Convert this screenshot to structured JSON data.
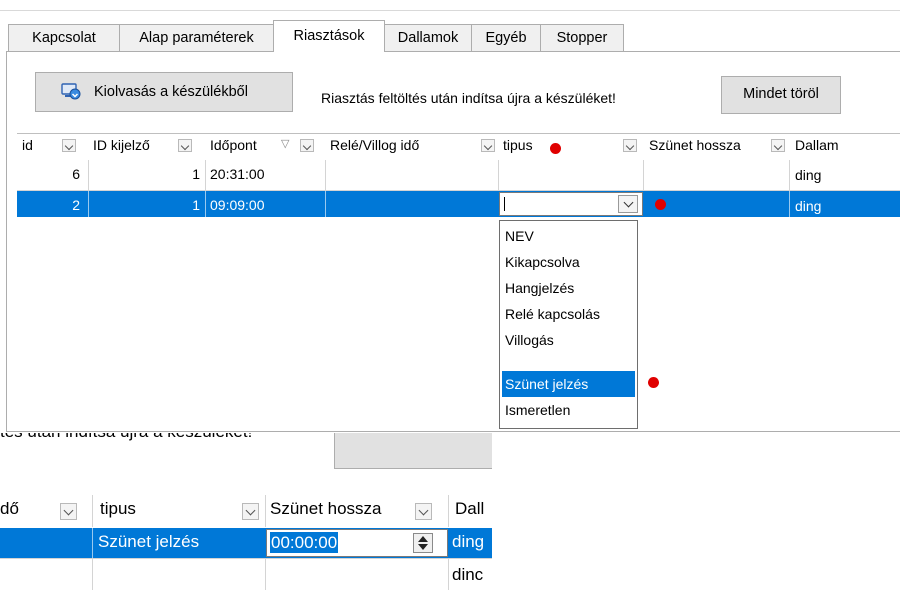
{
  "tabs": [
    {
      "label": "Kapcsolat"
    },
    {
      "label": "Alap paraméterek"
    },
    {
      "label": "Riasztások"
    },
    {
      "label": "Dallamok"
    },
    {
      "label": "Egyéb"
    },
    {
      "label": "Stopper"
    }
  ],
  "toolbar": {
    "read_button_label": "Kiolvasás a készülékből",
    "info_text": "Riasztás feltöltés után indítsa újra a készüléket!",
    "delete_all_label": "Mindet töröl"
  },
  "grid": {
    "columns": [
      "id",
      "ID kijelző",
      "Időpont",
      "Relé/Villog idő",
      "tipus",
      "Szünet hossza",
      "Dallam"
    ],
    "rows": [
      {
        "id": "6",
        "id_kijelzo": "1",
        "idopont": "20:31:00",
        "rele": "",
        "tipus": "",
        "szunet": "",
        "dallam": "ding"
      },
      {
        "id": "2",
        "id_kijelzo": "1",
        "idopont": "09:09:00",
        "rele": "",
        "tipus": "",
        "szunet": "",
        "dallam": "ding"
      }
    ]
  },
  "tipus_dropdown": {
    "options": [
      "NEV",
      "Kikapcsolva",
      "Hangjelzés",
      "Relé kapcsolás",
      "Villogás",
      "Szünet jelzés",
      "Ismeretlen"
    ],
    "highlighted": "Szünet jelzés"
  },
  "zoomed": {
    "info_fragment": "tés után indítsa újra a készüléket!",
    "col_rele_fragment": "dő",
    "col_tipus": "tipus",
    "col_szunet": "Szünet hossza",
    "col_dallam_fragment": "Dall",
    "row1_tipus": "Szünet jelzés",
    "row1_szunet": "00:00:00",
    "row1_dallam_fragment": "ding",
    "row2_dallam_fragment": "dinc"
  },
  "colors": {
    "selection": "#0078d7",
    "marker": "#e00000"
  }
}
